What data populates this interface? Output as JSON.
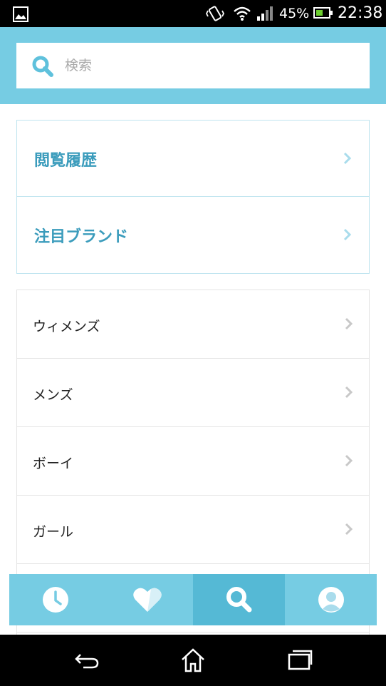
{
  "status_bar": {
    "battery_percent": "45%",
    "time": "22:38",
    "battery_color": "#6ccf2e"
  },
  "search": {
    "placeholder": "検索",
    "value": ""
  },
  "featured": [
    {
      "label": "閲覧履歴"
    },
    {
      "label": "注目ブランド"
    }
  ],
  "categories": [
    {
      "label": "ウィメンズ"
    },
    {
      "label": "メンズ"
    },
    {
      "label": "ボーイ"
    },
    {
      "label": "ガール"
    }
  ],
  "tabs": [
    {
      "icon": "clock-icon",
      "active": false
    },
    {
      "icon": "heart-icon",
      "active": false
    },
    {
      "icon": "search-icon",
      "active": true
    },
    {
      "icon": "profile-icon",
      "active": false
    }
  ],
  "colors": {
    "accent": "#76cce3",
    "accent_active": "#55b9d5",
    "featured_text": "#3b9cbc"
  }
}
